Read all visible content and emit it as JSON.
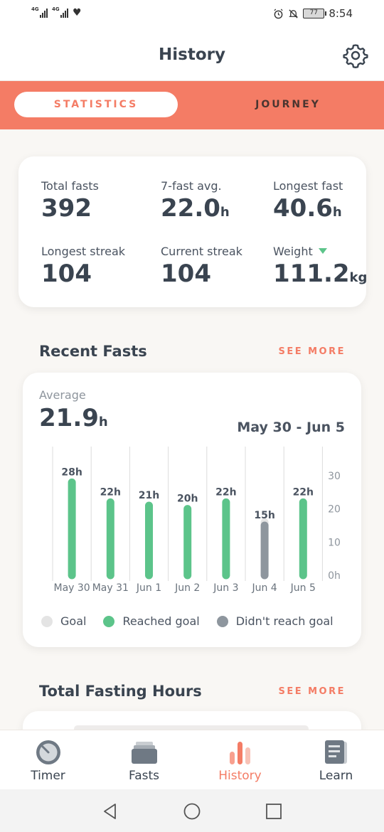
{
  "status_bar": {
    "time": "8:54",
    "battery": "77",
    "signal1": "4G",
    "signal2": "4G"
  },
  "header": {
    "title": "History",
    "settings_icon": "gear-icon"
  },
  "tabs": {
    "active": "STATISTICS",
    "inactive": "JOURNEY"
  },
  "stats": [
    {
      "label": "Total fasts",
      "value": "392",
      "unit": ""
    },
    {
      "label": "7-fast avg.",
      "value": "22.0",
      "unit": "h"
    },
    {
      "label": "Longest fast",
      "value": "40.6",
      "unit": "h"
    },
    {
      "label": "Longest streak",
      "value": "104",
      "unit": ""
    },
    {
      "label": "Current streak",
      "value": "104",
      "unit": ""
    },
    {
      "label": "Weight",
      "value": "111.2",
      "unit": "kg"
    }
  ],
  "recent": {
    "title": "Recent Fasts",
    "see_more": "SEE MORE",
    "average_label": "Average",
    "average_value": "21.9",
    "average_unit": "h",
    "range": "May 30 - Jun 5",
    "legend": {
      "goal": "Goal",
      "reached": "Reached goal",
      "missed": "Didn't reach goal"
    }
  },
  "chart_data": {
    "type": "bar",
    "categories": [
      "May 30",
      "May 31",
      "Jun 1",
      "Jun 2",
      "Jun 3",
      "Jun 4",
      "Jun 5"
    ],
    "values": [
      28,
      22,
      21,
      20,
      22,
      15,
      22
    ],
    "value_labels": [
      "28h",
      "22h",
      "21h",
      "20h",
      "22h",
      "15h",
      "22h"
    ],
    "goal": 16,
    "reached": [
      true,
      true,
      true,
      true,
      true,
      false,
      true
    ],
    "y_ticks": [
      "30",
      "20",
      "10",
      "0h"
    ],
    "ylim": [
      0,
      30
    ],
    "colors": {
      "reached": "#5cc48a",
      "missed": "#8e969e",
      "goal": "#e4e4e4",
      "grid": "#dcdcdc"
    }
  },
  "hours": {
    "title": "Total Fasting Hours",
    "see_more": "SEE MORE"
  },
  "nav": [
    {
      "label": "Timer",
      "icon": "timer-icon"
    },
    {
      "label": "Fasts",
      "icon": "fasts-icon"
    },
    {
      "label": "History",
      "icon": "history-icon"
    },
    {
      "label": "Learn",
      "icon": "learn-icon"
    }
  ],
  "colors": {
    "accent": "#f47c65",
    "text": "#3a4450",
    "green": "#5cc48a"
  }
}
